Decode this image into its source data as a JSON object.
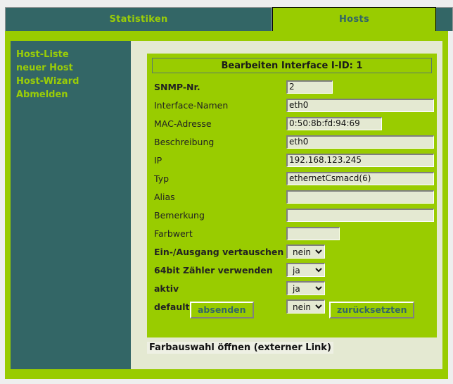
{
  "tabs": [
    {
      "label": "Statistiken",
      "active": false
    },
    {
      "label": "Hosts",
      "active": true
    }
  ],
  "sidebar": {
    "items": [
      {
        "label": "Host-Liste"
      },
      {
        "label": "neuer Host"
      },
      {
        "label": "Host-Wizard"
      },
      {
        "label": "Abmelden"
      }
    ]
  },
  "form": {
    "title": "Bearbeiten Interface I-ID: 1",
    "fields": [
      {
        "label": "SNMP-Nr.",
        "bold": true,
        "type": "text",
        "value": "2",
        "placeholder": "",
        "width": "w-short"
      },
      {
        "label": "Interface-Namen",
        "bold": false,
        "type": "text",
        "value": "eth0",
        "placeholder": "",
        "width": "w-long"
      },
      {
        "label": "MAC-Adresse",
        "bold": false,
        "type": "text",
        "value": "0:50:8b:fd:94:69",
        "placeholder": "",
        "width": "w-mac"
      },
      {
        "label": "Beschreibung",
        "bold": false,
        "type": "text",
        "value": "eth0",
        "placeholder": "",
        "width": "w-long"
      },
      {
        "label": "IP",
        "bold": false,
        "type": "text",
        "value": "192.168.123.245",
        "placeholder": "",
        "width": "w-long"
      },
      {
        "label": "Typ",
        "bold": false,
        "type": "text",
        "value": "ethernetCsmacd(6)",
        "placeholder": "",
        "width": "w-long"
      },
      {
        "label": "Alias",
        "bold": false,
        "type": "text",
        "value": "",
        "placeholder": "",
        "width": "w-long"
      },
      {
        "label": "Bemerkung",
        "bold": false,
        "type": "text",
        "value": "",
        "placeholder": "",
        "width": "w-long"
      },
      {
        "label": "Farbwert",
        "bold": false,
        "type": "text",
        "value": "",
        "placeholder": "",
        "width": "w-color"
      },
      {
        "label": "Ein-/Ausgang vertauschen",
        "bold": true,
        "type": "select",
        "value": "nein",
        "options": [
          "ja",
          "nein"
        ]
      },
      {
        "label": "64bit Zähler verwenden",
        "bold": true,
        "type": "select",
        "value": "ja",
        "options": [
          "ja",
          "nein"
        ]
      },
      {
        "label": "aktiv",
        "bold": true,
        "type": "select",
        "value": "ja",
        "options": [
          "ja",
          "nein"
        ]
      },
      {
        "label": "default",
        "bold": true,
        "type": "select",
        "value": "nein",
        "options": [
          "ja",
          "nein"
        ]
      }
    ],
    "buttons": {
      "submit_label": "absenden",
      "reset_label": "zurücksetzten"
    }
  },
  "footer": {
    "link_label": "Farbauswahl öffnen (externer Link)"
  },
  "colors": {
    "brand_green": "#99cc00",
    "dark_teal": "#336666",
    "link_green": "#9acd07",
    "panel_cream": "#e4e9d2",
    "page_gray": "#eeeeee"
  }
}
